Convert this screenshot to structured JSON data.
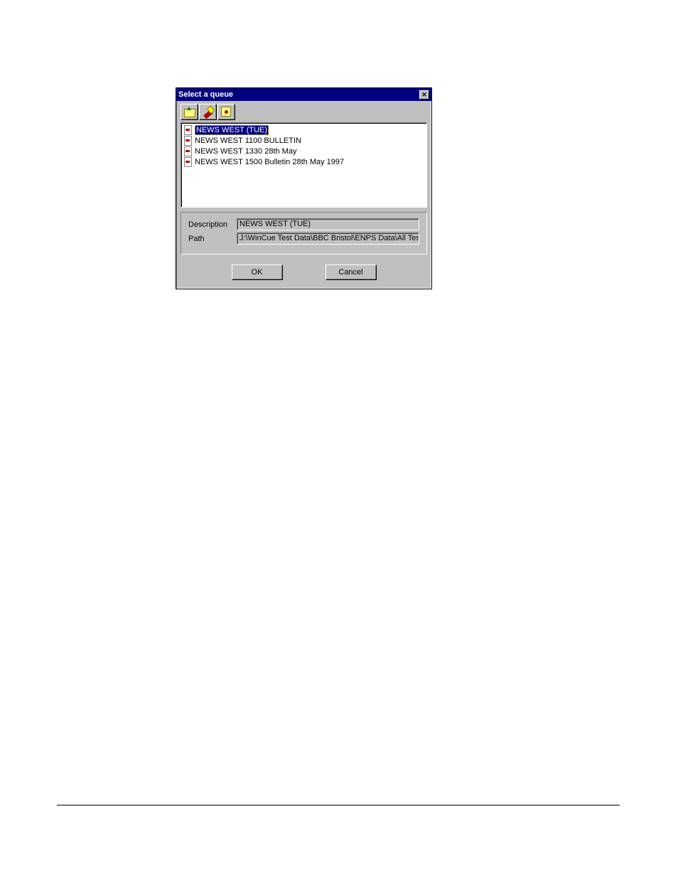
{
  "dialog": {
    "title": "Select a queue",
    "list_items": [
      {
        "label": "NEWS WEST (TUE)",
        "selected": true
      },
      {
        "label": "NEWS WEST 1100 BULLETIN",
        "selected": false
      },
      {
        "label": "NEWS WEST 1330 28th May",
        "selected": false
      },
      {
        "label": "NEWS WEST 1500 Bulletin 28th May 1997",
        "selected": false
      }
    ],
    "description_label": "Description",
    "description_value": "NEWS WEST (TUE)",
    "path_label": "Path",
    "path_value": "J:\\WinCue Test Data\\BBC Bristol\\ENPS Data\\All Test Data",
    "ok_label": "OK",
    "cancel_label": "Cancel"
  }
}
